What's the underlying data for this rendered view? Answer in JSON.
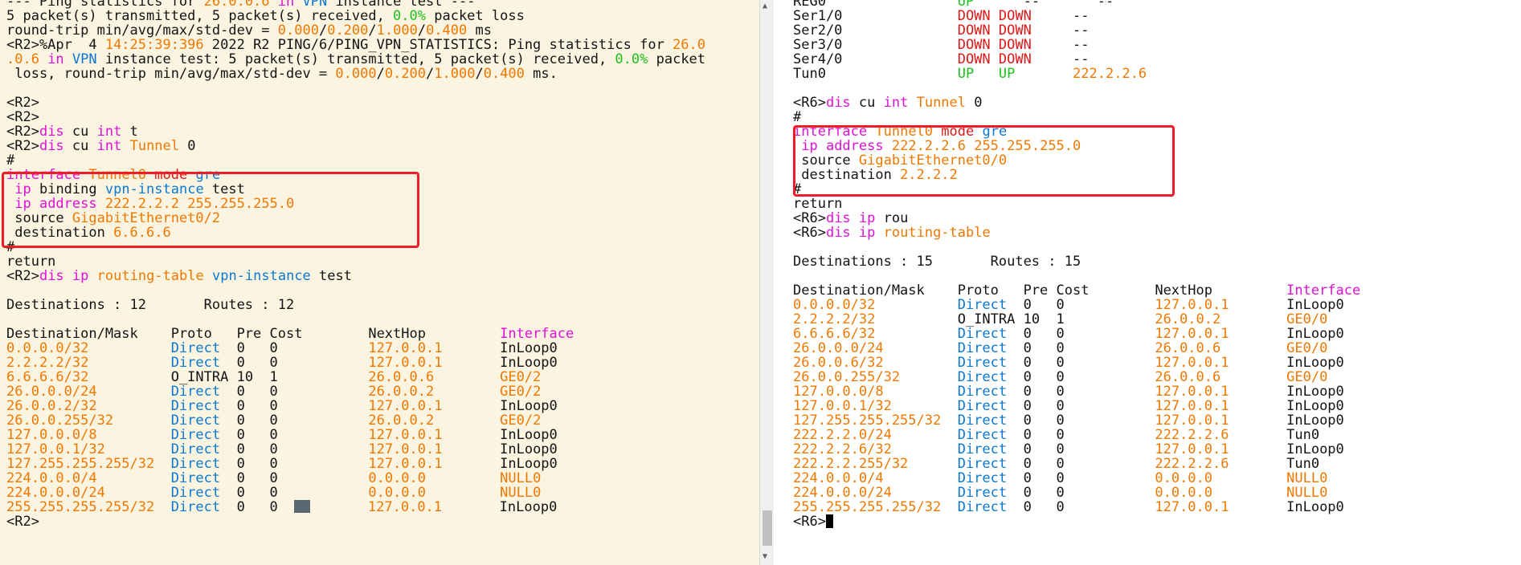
{
  "palette": {
    "text": "#141414",
    "orange": "#f07800",
    "magenta": "#e010d8",
    "blue": "#0a78d4",
    "green": "#20c020",
    "red": "#e01818",
    "left_bg": "#fbf4e0",
    "highlight_box": "#ee1c24"
  },
  "left_terminal": {
    "lines": [
      [
        [
          "w",
          "--- Ping statistics for "
        ],
        [
          "o",
          "26.0.0.6"
        ],
        [
          "m",
          " in "
        ],
        [
          "b",
          "VPN"
        ],
        [
          "w",
          " instance test ---"
        ]
      ],
      [
        [
          "w",
          "5 packet(s) transmitted, 5 packet(s) received, "
        ],
        [
          "g",
          "0.0%"
        ],
        [
          "w",
          " packet loss"
        ]
      ],
      [
        [
          "w",
          "round-trip min/avg/max/std-dev = "
        ],
        [
          "o",
          "0.000"
        ],
        [
          "w",
          "/"
        ],
        [
          "o",
          "0.200"
        ],
        [
          "w",
          "/"
        ],
        [
          "o",
          "1.000"
        ],
        [
          "w",
          "/"
        ],
        [
          "o",
          "0.400"
        ],
        [
          "w",
          " ms"
        ]
      ],
      [
        [
          "w",
          "<R2>%Apr  4 "
        ],
        [
          "o",
          "14:25:39:396"
        ],
        [
          "w",
          " 2022 R2 PING/6/PING_VPN_STATISTICS: Ping statistics for "
        ],
        [
          "o",
          "26.0"
        ]
      ],
      [
        [
          "o",
          ".0.6"
        ],
        [
          "m",
          " in "
        ],
        [
          "b",
          "VPN"
        ],
        [
          "w",
          " instance test: 5 packet(s) transmitted, 5 packet(s) received, "
        ],
        [
          "g",
          "0.0%"
        ],
        [
          "w",
          " packet"
        ]
      ],
      [
        [
          "w",
          " loss, round-trip min/avg/max/std-dev = "
        ],
        [
          "o",
          "0.000"
        ],
        [
          "w",
          "/"
        ],
        [
          "o",
          "0.200"
        ],
        [
          "w",
          "/"
        ],
        [
          "o",
          "1.000"
        ],
        [
          "w",
          "/"
        ],
        [
          "o",
          "0.400"
        ],
        [
          "w",
          " ms."
        ]
      ],
      [],
      [
        [
          "w",
          "<R2>"
        ]
      ],
      [
        [
          "w",
          "<R2>"
        ]
      ],
      [
        [
          "w",
          "<R2>"
        ],
        [
          "m",
          "dis"
        ],
        [
          "w",
          " cu "
        ],
        [
          "m",
          "int"
        ],
        [
          "w",
          " t"
        ]
      ],
      [
        [
          "w",
          "<R2>"
        ],
        [
          "m",
          "dis"
        ],
        [
          "w",
          " cu "
        ],
        [
          "m",
          "int"
        ],
        [
          "w",
          " "
        ],
        [
          "o",
          "Tunnel"
        ],
        [
          "w",
          " 0"
        ]
      ],
      [
        [
          "w",
          "#"
        ]
      ],
      [
        [
          "m",
          "interface"
        ],
        [
          "w",
          " "
        ],
        [
          "o",
          "Tunnel0"
        ],
        [
          "w",
          " "
        ],
        [
          "r",
          "mode"
        ],
        [
          "w",
          " "
        ],
        [
          "b",
          "gre"
        ]
      ],
      [
        [
          "w",
          " "
        ],
        [
          "m",
          "ip"
        ],
        [
          "w",
          " binding "
        ],
        [
          "b",
          "vpn-instance"
        ],
        [
          "w",
          " test"
        ]
      ],
      [
        [
          "w",
          " "
        ],
        [
          "m",
          "ip address"
        ],
        [
          "w",
          " "
        ],
        [
          "o",
          "222.2.2.2 255.255.255.0"
        ]
      ],
      [
        [
          "w",
          " source "
        ],
        [
          "o",
          "GigabitEthernet0/2"
        ]
      ],
      [
        [
          "w",
          " destination "
        ],
        [
          "o",
          "6.6.6.6"
        ]
      ],
      [
        [
          "w",
          "#"
        ]
      ],
      [
        [
          "w",
          "return"
        ]
      ],
      [
        [
          "w",
          "<R2>"
        ],
        [
          "m",
          "dis"
        ],
        [
          "w",
          " "
        ],
        [
          "m",
          "ip"
        ],
        [
          "w",
          " "
        ],
        [
          "o",
          "routing-table"
        ],
        [
          "w",
          " "
        ],
        [
          "b",
          "vpn-instance"
        ],
        [
          "w",
          " test"
        ]
      ],
      [],
      [
        [
          "w",
          "Destinations : 12       Routes : 12"
        ]
      ],
      [],
      [
        [
          "w",
          "Destination/Mask    Proto   Pre Cost        NextHop         "
        ],
        [
          "m",
          "Interface"
        ]
      ],
      [
        [
          "o",
          "0.0.0.0/32          "
        ],
        [
          "b",
          "Direct"
        ],
        [
          "w",
          "  0   0           "
        ],
        [
          "o",
          "127.0.0.1       "
        ],
        [
          "w",
          "InLoop0"
        ]
      ],
      [
        [
          "o",
          "2.2.2.2/32          "
        ],
        [
          "b",
          "Direct"
        ],
        [
          "w",
          "  0   0           "
        ],
        [
          "o",
          "127.0.0.1       "
        ],
        [
          "w",
          "InLoop0"
        ]
      ],
      [
        [
          "o",
          "6.6.6.6/32          "
        ],
        [
          "w",
          "O_INTRA 10  1           "
        ],
        [
          "o",
          "26.0.0.6        "
        ],
        [
          "o",
          "GE0/2"
        ]
      ],
      [
        [
          "o",
          "26.0.0.0/24         "
        ],
        [
          "b",
          "Direct"
        ],
        [
          "w",
          "  0   0           "
        ],
        [
          "o",
          "26.0.0.2        "
        ],
        [
          "o",
          "GE0/2"
        ]
      ],
      [
        [
          "o",
          "26.0.0.2/32         "
        ],
        [
          "b",
          "Direct"
        ],
        [
          "w",
          "  0   0           "
        ],
        [
          "o",
          "127.0.0.1       "
        ],
        [
          "w",
          "InLoop0"
        ]
      ],
      [
        [
          "o",
          "26.0.0.255/32       "
        ],
        [
          "b",
          "Direct"
        ],
        [
          "w",
          "  0   0           "
        ],
        [
          "o",
          "26.0.0.2        "
        ],
        [
          "o",
          "GE0/2"
        ]
      ],
      [
        [
          "o",
          "127.0.0.0/8         "
        ],
        [
          "b",
          "Direct"
        ],
        [
          "w",
          "  0   0           "
        ],
        [
          "o",
          "127.0.0.1       "
        ],
        [
          "w",
          "InLoop0"
        ]
      ],
      [
        [
          "o",
          "127.0.0.1/32        "
        ],
        [
          "b",
          "Direct"
        ],
        [
          "w",
          "  0   0           "
        ],
        [
          "o",
          "127.0.0.1       "
        ],
        [
          "w",
          "InLoop0"
        ]
      ],
      [
        [
          "o",
          "127.255.255.255/32  "
        ],
        [
          "b",
          "Direct"
        ],
        [
          "w",
          "  0   0           "
        ],
        [
          "o",
          "127.0.0.1       "
        ],
        [
          "w",
          "InLoop0"
        ]
      ],
      [
        [
          "o",
          "224.0.0.0/4         "
        ],
        [
          "b",
          "Direct"
        ],
        [
          "w",
          "  0   0           "
        ],
        [
          "o",
          "0.0.0.0         "
        ],
        [
          "o",
          "NULL0"
        ]
      ],
      [
        [
          "o",
          "224.0.0.0/24        "
        ],
        [
          "b",
          "Direct"
        ],
        [
          "w",
          "  0   0           "
        ],
        [
          "o",
          "0.0.0.0         "
        ],
        [
          "o",
          "NULL0"
        ]
      ],
      [
        [
          "o",
          "255.255.255.255/32  "
        ],
        [
          "b",
          "Direct"
        ],
        [
          "w",
          "  0   0  "
        ],
        [
          "cblock",
          ""
        ],
        [
          "w",
          "       "
        ],
        [
          "o",
          "127.0.0.1       "
        ],
        [
          "w",
          "InLoop0"
        ]
      ],
      [
        [
          "w",
          "<R2>"
        ]
      ]
    ]
  },
  "right_terminal": {
    "lines": [
      [
        [
          "w",
          "REG0                "
        ],
        [
          "g",
          "UP"
        ],
        [
          "w",
          "      --       --"
        ]
      ],
      [
        [
          "w",
          "Ser1/0              "
        ],
        [
          "r",
          "DOWN DOWN"
        ],
        [
          "w",
          "     --"
        ]
      ],
      [
        [
          "w",
          "Ser2/0              "
        ],
        [
          "r",
          "DOWN DOWN"
        ],
        [
          "w",
          "     --"
        ]
      ],
      [
        [
          "w",
          "Ser3/0              "
        ],
        [
          "r",
          "DOWN DOWN"
        ],
        [
          "w",
          "     --"
        ]
      ],
      [
        [
          "w",
          "Ser4/0              "
        ],
        [
          "r",
          "DOWN DOWN"
        ],
        [
          "w",
          "     --"
        ]
      ],
      [
        [
          "w",
          "Tun0                "
        ],
        [
          "g",
          "UP   UP"
        ],
        [
          "w",
          "       "
        ],
        [
          "o",
          "222.2.2.6"
        ]
      ],
      [],
      [
        [
          "w",
          "<R6>"
        ],
        [
          "m",
          "dis"
        ],
        [
          "w",
          " cu "
        ],
        [
          "m",
          "int"
        ],
        [
          "w",
          " "
        ],
        [
          "o",
          "Tunnel"
        ],
        [
          "w",
          " 0"
        ]
      ],
      [
        [
          "w",
          "#"
        ]
      ],
      [
        [
          "m",
          "interface"
        ],
        [
          "w",
          " "
        ],
        [
          "o",
          "Tunnel0"
        ],
        [
          "w",
          " "
        ],
        [
          "r",
          "mode"
        ],
        [
          "w",
          " "
        ],
        [
          "b",
          "gre"
        ]
      ],
      [
        [
          "w",
          " "
        ],
        [
          "m",
          "ip address"
        ],
        [
          "w",
          " "
        ],
        [
          "o",
          "222.2.2.6 255.255.255.0"
        ]
      ],
      [
        [
          "w",
          " source "
        ],
        [
          "o",
          "GigabitEthernet0/0"
        ]
      ],
      [
        [
          "w",
          " destination "
        ],
        [
          "o",
          "2.2.2.2"
        ]
      ],
      [
        [
          "w",
          "#"
        ]
      ],
      [
        [
          "w",
          "return"
        ]
      ],
      [
        [
          "w",
          "<R6>"
        ],
        [
          "m",
          "dis"
        ],
        [
          "w",
          " "
        ],
        [
          "m",
          "ip"
        ],
        [
          "w",
          " rou"
        ]
      ],
      [
        [
          "w",
          "<R6>"
        ],
        [
          "m",
          "dis"
        ],
        [
          "w",
          " "
        ],
        [
          "m",
          "ip"
        ],
        [
          "w",
          " "
        ],
        [
          "o",
          "routing-table"
        ]
      ],
      [],
      [
        [
          "w",
          "Destinations : 15       Routes : 15"
        ]
      ],
      [],
      [
        [
          "w",
          "Destination/Mask    Proto   Pre Cost        NextHop         "
        ],
        [
          "m",
          "Interface"
        ]
      ],
      [
        [
          "o",
          "0.0.0.0/32          "
        ],
        [
          "b",
          "Direct"
        ],
        [
          "w",
          "  0   0           "
        ],
        [
          "o",
          "127.0.0.1       "
        ],
        [
          "w",
          "InLoop0"
        ]
      ],
      [
        [
          "o",
          "2.2.2.2/32          "
        ],
        [
          "w",
          "O_INTRA 10  1           "
        ],
        [
          "o",
          "26.0.0.2        "
        ],
        [
          "o",
          "GE0/0"
        ]
      ],
      [
        [
          "o",
          "6.6.6.6/32          "
        ],
        [
          "b",
          "Direct"
        ],
        [
          "w",
          "  0   0           "
        ],
        [
          "o",
          "127.0.0.1       "
        ],
        [
          "w",
          "InLoop0"
        ]
      ],
      [
        [
          "o",
          "26.0.0.0/24         "
        ],
        [
          "b",
          "Direct"
        ],
        [
          "w",
          "  0   0           "
        ],
        [
          "o",
          "26.0.0.6        "
        ],
        [
          "o",
          "GE0/0"
        ]
      ],
      [
        [
          "o",
          "26.0.0.6/32         "
        ],
        [
          "b",
          "Direct"
        ],
        [
          "w",
          "  0   0           "
        ],
        [
          "o",
          "127.0.0.1       "
        ],
        [
          "w",
          "InLoop0"
        ]
      ],
      [
        [
          "o",
          "26.0.0.255/32       "
        ],
        [
          "b",
          "Direct"
        ],
        [
          "w",
          "  0   0           "
        ],
        [
          "o",
          "26.0.0.6        "
        ],
        [
          "o",
          "GE0/0"
        ]
      ],
      [
        [
          "o",
          "127.0.0.0/8         "
        ],
        [
          "b",
          "Direct"
        ],
        [
          "w",
          "  0   0           "
        ],
        [
          "o",
          "127.0.0.1       "
        ],
        [
          "w",
          "InLoop0"
        ]
      ],
      [
        [
          "o",
          "127.0.0.1/32        "
        ],
        [
          "b",
          "Direct"
        ],
        [
          "w",
          "  0   0           "
        ],
        [
          "o",
          "127.0.0.1       "
        ],
        [
          "w",
          "InLoop0"
        ]
      ],
      [
        [
          "o",
          "127.255.255.255/32  "
        ],
        [
          "b",
          "Direct"
        ],
        [
          "w",
          "  0   0           "
        ],
        [
          "o",
          "127.0.0.1       "
        ],
        [
          "w",
          "InLoop0"
        ]
      ],
      [
        [
          "o",
          "222.2.2.0/24        "
        ],
        [
          "b",
          "Direct"
        ],
        [
          "w",
          "  0   0           "
        ],
        [
          "o",
          "222.2.2.6       "
        ],
        [
          "w",
          "Tun0"
        ]
      ],
      [
        [
          "o",
          "222.2.2.6/32        "
        ],
        [
          "b",
          "Direct"
        ],
        [
          "w",
          "  0   0           "
        ],
        [
          "o",
          "127.0.0.1       "
        ],
        [
          "w",
          "InLoop0"
        ]
      ],
      [
        [
          "o",
          "222.2.2.255/32      "
        ],
        [
          "b",
          "Direct"
        ],
        [
          "w",
          "  0   0           "
        ],
        [
          "o",
          "222.2.2.6       "
        ],
        [
          "w",
          "Tun0"
        ]
      ],
      [
        [
          "o",
          "224.0.0.0/4         "
        ],
        [
          "b",
          "Direct"
        ],
        [
          "w",
          "  0   0           "
        ],
        [
          "o",
          "0.0.0.0         "
        ],
        [
          "o",
          "NULL0"
        ]
      ],
      [
        [
          "o",
          "224.0.0.0/24        "
        ],
        [
          "b",
          "Direct"
        ],
        [
          "w",
          "  0   0           "
        ],
        [
          "o",
          "0.0.0.0         "
        ],
        [
          "o",
          "NULL0"
        ]
      ],
      [
        [
          "o",
          "255.255.255.255/32  "
        ],
        [
          "b",
          "Direct"
        ],
        [
          "w",
          "  0   0           "
        ],
        [
          "o",
          "127.0.0.1       "
        ],
        [
          "w",
          "InLoop0"
        ]
      ],
      [
        [
          "w",
          "<R6>"
        ],
        [
          "ccur",
          ""
        ]
      ]
    ]
  }
}
